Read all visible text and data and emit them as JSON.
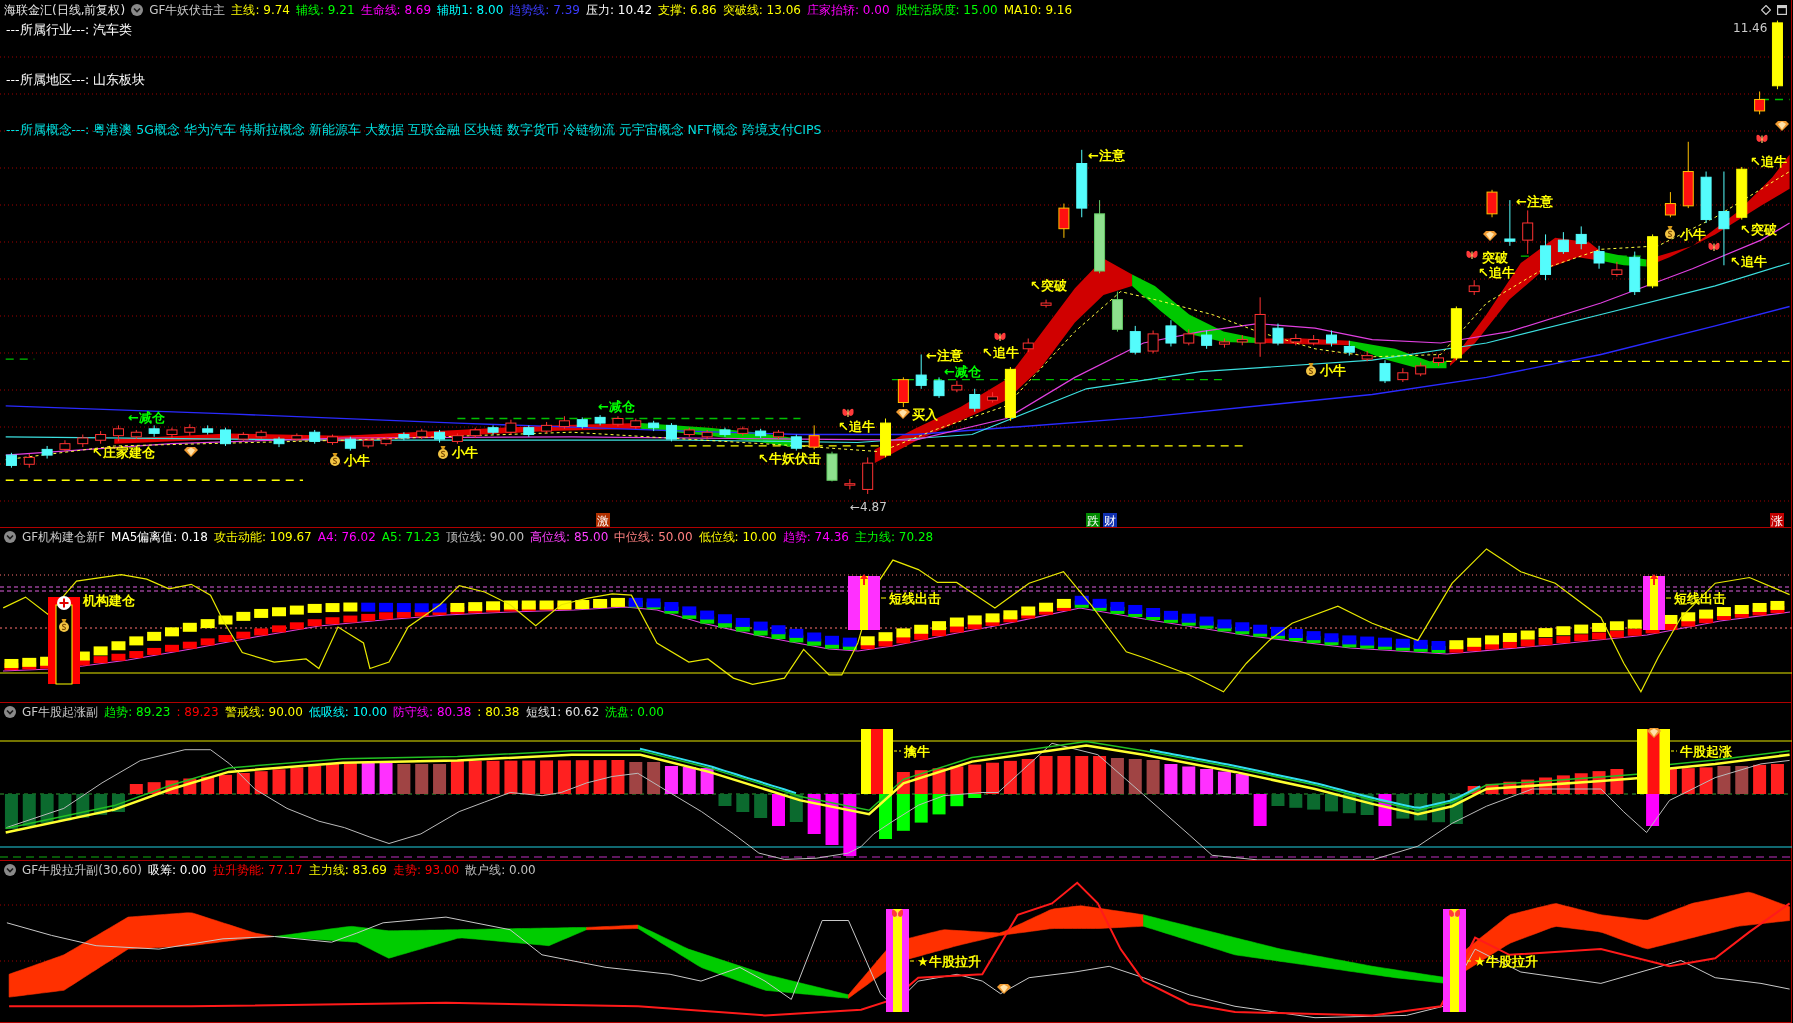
{
  "main_panel": {
    "stock_title": "海联金汇(日线,前复权)",
    "indicator": "GF牛妖伏击主",
    "values": [
      {
        "text": "主线: 9.74",
        "color": "#ffff00"
      },
      {
        "text": "辅线: 9.21",
        "color": "#00ff00"
      },
      {
        "text": "生命线: 8.69",
        "color": "#ff00ff"
      },
      {
        "text": "辅助1: 8.00",
        "color": "#00ffff"
      },
      {
        "text": "趋势线: 7.39",
        "color": "#3c3cff"
      },
      {
        "text": "压力: 10.42",
        "color": "#ffffff"
      },
      {
        "text": "支撑: 6.86",
        "color": "#ffff00"
      },
      {
        "text": "突破线: 13.06",
        "color": "#ffff00"
      },
      {
        "text": "庄家抬轿: 0.00",
        "color": "#ff00ff"
      },
      {
        "text": "股性活跃度: 15.00",
        "color": "#00ff00"
      },
      {
        "text": "MA10: 9.16",
        "color": "#ffff00"
      }
    ],
    "info_lines": [
      {
        "text": "---所属行业---: 汽车类",
        "color": "#ffffff"
      },
      {
        "text": "---所属地区---: 山东板块",
        "color": "#ffffff"
      },
      {
        "text": "---所属概念---: 粤港澳 5G概念 华为汽车 特斯拉概念 新能源车 大数据 互联金融 区块链 数字货币 冷链物流 元宇宙概念 NFT概念 跨境支付CIPS",
        "color": "#00e0e0"
      }
    ],
    "price_high": "11.46",
    "price_low": "←4.87",
    "signals": [
      {
        "text": "←减仓",
        "color": "#00ff00"
      },
      {
        "text": "↖庄家建仓",
        "color": "#ffff00"
      },
      {
        "text": "小牛",
        "color": "#ffff00"
      },
      {
        "text": "小牛",
        "color": "#ffff00"
      },
      {
        "text": "←减仓",
        "color": "#00ff00"
      },
      {
        "text": "↖牛妖伏击",
        "color": "#ffff00"
      },
      {
        "text": "←注意",
        "color": "#ffff00"
      },
      {
        "text": "←减仓",
        "color": "#00ff00"
      },
      {
        "text": "买入",
        "color": "#ffff00"
      },
      {
        "text": "↖追牛",
        "color": "#ffff00"
      },
      {
        "text": "←注意",
        "color": "#ffff00"
      },
      {
        "text": "↖突破",
        "color": "#ffff00"
      },
      {
        "text": "↖追牛",
        "color": "#ffff00"
      },
      {
        "text": "小牛",
        "color": "#ffff00"
      },
      {
        "text": "←注意",
        "color": "#ffff00"
      },
      {
        "text": "突破",
        "color": "#ffff00"
      },
      {
        "text": "↖追牛",
        "color": "#ffff00"
      },
      {
        "text": "小牛",
        "color": "#ffff00"
      },
      {
        "text": "↖追牛",
        "color": "#ffff00"
      },
      {
        "text": "↖突破",
        "color": "#ffff00"
      },
      {
        "text": "↖追牛",
        "color": "#ffff00"
      }
    ],
    "day_markers": [
      {
        "text": "激",
        "color": "#b03000"
      },
      {
        "text": "跌",
        "color": "#008a00"
      },
      {
        "text": "财",
        "color": "#1030b0"
      },
      {
        "text": "涨",
        "color": "#c00000"
      }
    ]
  },
  "panel_2": {
    "indicator": "GF机构建仓新F",
    "values": [
      {
        "text": "MA5偏离值: 0.18",
        "color": "#ffffff"
      },
      {
        "text": "攻击动能: 109.67",
        "color": "#ffff00"
      },
      {
        "text": "A4: 76.02",
        "color": "#ff00ff"
      },
      {
        "text": "A5: 71.23",
        "color": "#00ff00"
      },
      {
        "text": "顶位线: 90.00",
        "color": "#c0c0c0"
      },
      {
        "text": "高位线: 85.00",
        "color": "#ff40ff"
      },
      {
        "text": "中位线: 50.00",
        "color": "#ff8080"
      },
      {
        "text": "低位线: 10.00",
        "color": "#ffff00"
      },
      {
        "text": "趋势: 74.36",
        "color": "#ff00ff"
      },
      {
        "text": "主力线: 70.28",
        "color": "#00ff00"
      }
    ],
    "signals": [
      "机构建仓",
      "短线出击",
      "短线出击"
    ]
  },
  "panel_3": {
    "indicator": "GF牛股起涨副",
    "values": [
      {
        "text": "趋势: 89.23",
        "color": "#00ff00"
      },
      {
        "text": ": 89.23",
        "color": "#ff0000"
      },
      {
        "text": "警戒线: 90.00",
        "color": "#ffff00"
      },
      {
        "text": "低吸线: 10.00",
        "color": "#00ffff"
      },
      {
        "text": "防守线: 80.38",
        "color": "#ff00ff"
      },
      {
        "text": ": 80.38",
        "color": "#ffff00"
      },
      {
        "text": "短线1: 60.62",
        "color": "#e0e0e0"
      },
      {
        "text": "洗盘: 0.00",
        "color": "#00ff00"
      }
    ],
    "signals": [
      "擒牛",
      "牛股起涨"
    ]
  },
  "panel_4": {
    "indicator": "GF牛股拉升副(30,60)",
    "values": [
      {
        "text": "吸筹: 0.00",
        "color": "#ffffff"
      },
      {
        "text": "拉升势能: 77.17",
        "color": "#ff0000"
      },
      {
        "text": "主力线: 83.69",
        "color": "#ffff00"
      },
      {
        "text": "走势: 93.00",
        "color": "#ff0000"
      },
      {
        "text": "散户线: 0.00",
        "color": "#c0c0c0"
      }
    ],
    "signals": [
      "★牛股拉升",
      "★牛股拉升"
    ]
  }
}
